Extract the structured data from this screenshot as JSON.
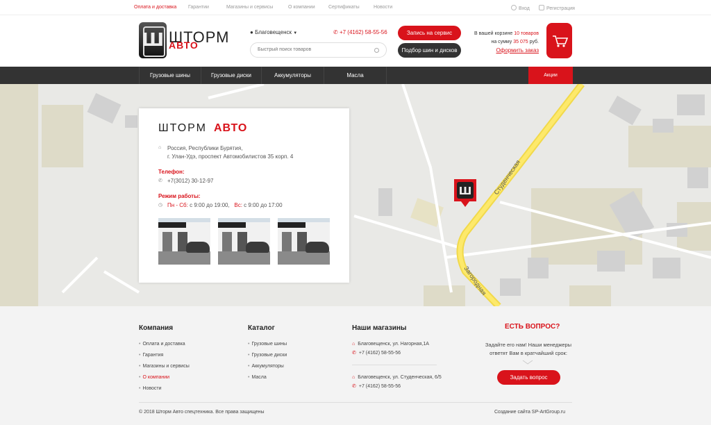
{
  "toplinks": {
    "items": [
      {
        "label": "Оплата и доставка",
        "active": true
      },
      {
        "label": "Гарантии",
        "active": false
      },
      {
        "label": "Магазины и сервисы",
        "active": false
      },
      {
        "label": "О компании",
        "active": false
      },
      {
        "label": "Сертификаты",
        "active": false
      },
      {
        "label": "Новости",
        "active": false
      }
    ],
    "login": "Вход",
    "register": "Регистрация"
  },
  "header": {
    "logo_glyph": "Ш",
    "logo_line1": "ШТОРМ",
    "logo_line2": "АВТО",
    "city": "Благовещенск",
    "phone": "+7 (4162) 58-55-56",
    "search_placeholder": "Быстрый поиск товаров",
    "btn_service": "Запись на сервис",
    "btn_select": "Подбор шин и дисков",
    "cart_line1_pre": "В вашей корзине",
    "cart_count": "10 товаров",
    "cart_line2_pre": "на сумму",
    "cart_sum": "35 075",
    "cart_currency": "руб.",
    "cart_link": "Оформить заказ"
  },
  "nav": {
    "items": [
      "Грузовые шины",
      "Грузовые диски",
      "Аккумуляторы",
      "Масла"
    ],
    "promo": "Акции"
  },
  "map": {
    "street1": "Студенческая",
    "street2": "Загородная",
    "marker_glyph": "Ш"
  },
  "card": {
    "logo_line1": "ШТОРМ",
    "logo_line2": "АВТО",
    "address_line1": "Россия, Республики Бурятия,",
    "address_line2": "г. Улан-Удэ, проспект Автомобилистов 35 корп. 4",
    "phone_label": "Телефон:",
    "phone": "+7(3012) 30-12-97",
    "hours_label": "Режим работы:",
    "hours_days1": "Пн - Сб:",
    "hours_time1": "с 9:00 до 19:00,",
    "hours_days2": "Вс:",
    "hours_time2": "с 9:00 до 17:00"
  },
  "footer": {
    "company_head": "Компания",
    "company_items": [
      "Оплата и доставка",
      "Гарантия",
      "Магазины и сервисы",
      "О компании",
      "Новости"
    ],
    "catalog_head": "Каталог",
    "catalog_items": [
      "Грузовые шины",
      "Грузовые диски",
      "Аккумуляторы",
      "Масла"
    ],
    "stores_head": "Наши магазины",
    "store1_addr": "Благовещенск, ул. Нагорная,1А",
    "store1_phone": "+7 (4162) 58-55-56",
    "store2_addr": "Благовещенск, ул. Студенческая, 6/5",
    "store2_phone": "+7 (4162) 58-55-56",
    "question_head": "ЕСТЬ ВОПРОС?",
    "question_text1": "Задайте его нам! Наши менеджеры",
    "question_text2": "ответят Вам в кратчайший срок:",
    "question_btn": "Задать вопрос",
    "copyright": "© 2018 Шторм Авто спецтехника. Все права защищены",
    "credits": "Создание сайта SP-ArtGroup.ru"
  },
  "colors": {
    "accent": "#d9131b",
    "dark": "#333333",
    "footer_bg": "#f3f3f3"
  }
}
